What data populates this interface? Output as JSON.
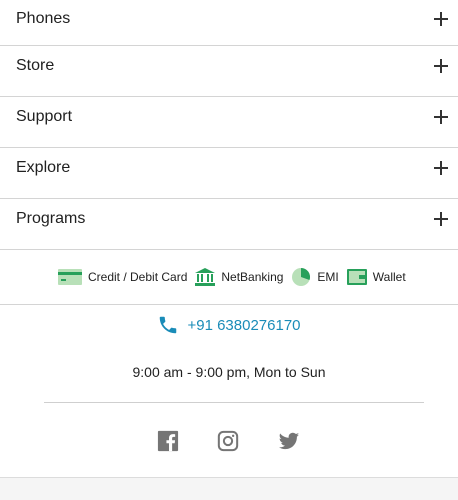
{
  "accordion": {
    "items": [
      {
        "label": "Phones"
      },
      {
        "label": "Store"
      },
      {
        "label": "Support"
      },
      {
        "label": "Explore"
      },
      {
        "label": "Programs"
      }
    ]
  },
  "payments": {
    "items": [
      {
        "label": "Credit / Debit Card",
        "icon": "credit-card-icon"
      },
      {
        "label": "NetBanking",
        "icon": "bank-icon"
      },
      {
        "label": "EMI",
        "icon": "pie-chart-icon"
      },
      {
        "label": "Wallet",
        "icon": "wallet-icon"
      }
    ]
  },
  "contact": {
    "phone": "+91 6380276170",
    "hours": "9:00 am - 9:00 pm, Mon to Sun"
  },
  "social": {
    "items": [
      "facebook-icon",
      "instagram-icon",
      "twitter-icon"
    ]
  },
  "colors": {
    "link": "#1a8cb8",
    "icon_green": "#27a05a",
    "social_gray": "#757575"
  }
}
